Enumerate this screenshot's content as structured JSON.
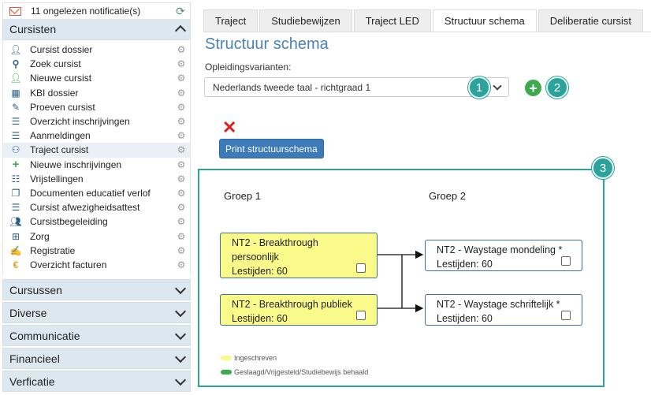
{
  "sidebar": {
    "notification_text": "11 ongelezen notificatie(s)",
    "sections": {
      "cursisten": "Cursisten",
      "cursussen": "Cursussen",
      "diverse": "Diverse",
      "communicatie": "Communicatie",
      "financieel": "Financieel",
      "verficatie": "Verficatie"
    },
    "items": [
      {
        "label": "Cursist dossier",
        "icon": "person-icon"
      },
      {
        "label": "Zoek cursist",
        "icon": "search-icon"
      },
      {
        "label": "Nieuwe cursist",
        "icon": "add-user-icon"
      },
      {
        "label": "KBI dossier",
        "icon": "building-icon"
      },
      {
        "label": "Proeven cursist",
        "icon": "pencil-icon"
      },
      {
        "label": "Overzicht inschrijvingen",
        "icon": "list-icon"
      },
      {
        "label": "Aanmeldingen",
        "icon": "list-icon"
      },
      {
        "label": "Traject cursist",
        "icon": "route-icon"
      },
      {
        "label": "Nieuwe inschrijvingen",
        "icon": "plus-icon"
      },
      {
        "label": "Vrijstellingen",
        "icon": "checklist-icon"
      },
      {
        "label": "Documenten educatief verlof",
        "icon": "copy-icon"
      },
      {
        "label": "Cursist afwezigheidsattest",
        "icon": "form-icon"
      },
      {
        "label": "Cursistbegeleiding",
        "icon": "users-icon"
      },
      {
        "label": "Zorg",
        "icon": "medkit-icon"
      },
      {
        "label": "Registratie",
        "icon": "edit-icon"
      },
      {
        "label": "Overzicht facturen",
        "icon": "euro-icon"
      }
    ]
  },
  "tabs": [
    "Traject",
    "Studiebewijzen",
    "Traject LED",
    "Structuur schema",
    "Deliberatie cursist"
  ],
  "main": {
    "title": "Structuur schema",
    "variants_label": "Opleidingsvarianten:",
    "selected_variant": "Nederlands tweede taal - richtgraad 1",
    "print_button": "Print structuurschema",
    "badges": [
      "1",
      "2",
      "3"
    ]
  },
  "schema": {
    "groups": [
      "Groep 1",
      "Groep 2"
    ],
    "nodes": [
      {
        "title": "NT2 - Breakthrough persoonlijk",
        "title_line1": "NT2 - Breakthrough",
        "title_line2": "persoonlijk",
        "hours": "Lestijden: 60"
      },
      {
        "title": "NT2 - Breakthrough publiek",
        "hours": "Lestijden: 60"
      },
      {
        "title": "NT2 - Waystage mondeling *",
        "hours": "Lestijden: 60"
      },
      {
        "title": "NT2 - Waystage schriftelijk *",
        "hours": "Lestijden: 60"
      }
    ],
    "legend": [
      {
        "label": "Ingeschreven",
        "color": "#fafa8a"
      },
      {
        "label": "Geslaagd/Vrijgesteld/Studiebewijs behaald",
        "color": "#3daa4d"
      }
    ]
  },
  "colors": {
    "accent": "#4a83b6",
    "teal": "#2ba39a",
    "button": "#3d7ab8",
    "node_yellow": "#fafa8a"
  }
}
